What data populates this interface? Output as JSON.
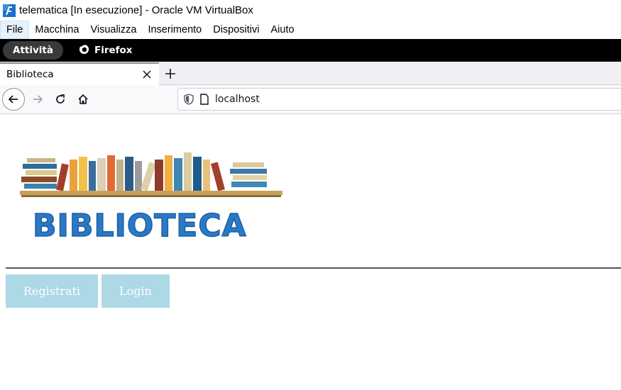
{
  "window": {
    "title": "telematica [In esecuzione] - Oracle VM VirtualBox",
    "icon": "virtualbox-icon"
  },
  "vbox_menu": {
    "items": [
      "File",
      "Macchina",
      "Visualizza",
      "Inserimento",
      "Dispositivi",
      "Aiuto"
    ],
    "active": "File"
  },
  "gnome": {
    "activities": "Attività",
    "app_name": "Firefox"
  },
  "browser": {
    "tab_title": "Biblioteca",
    "url": "localhost"
  },
  "page": {
    "logo_text": "BIBLIOTECA",
    "buttons": {
      "register": "Registrati",
      "login": "Login"
    }
  },
  "colors": {
    "button_bg": "#add8e6",
    "button_text": "#ffffff",
    "logo_text": "#2a79c4"
  }
}
